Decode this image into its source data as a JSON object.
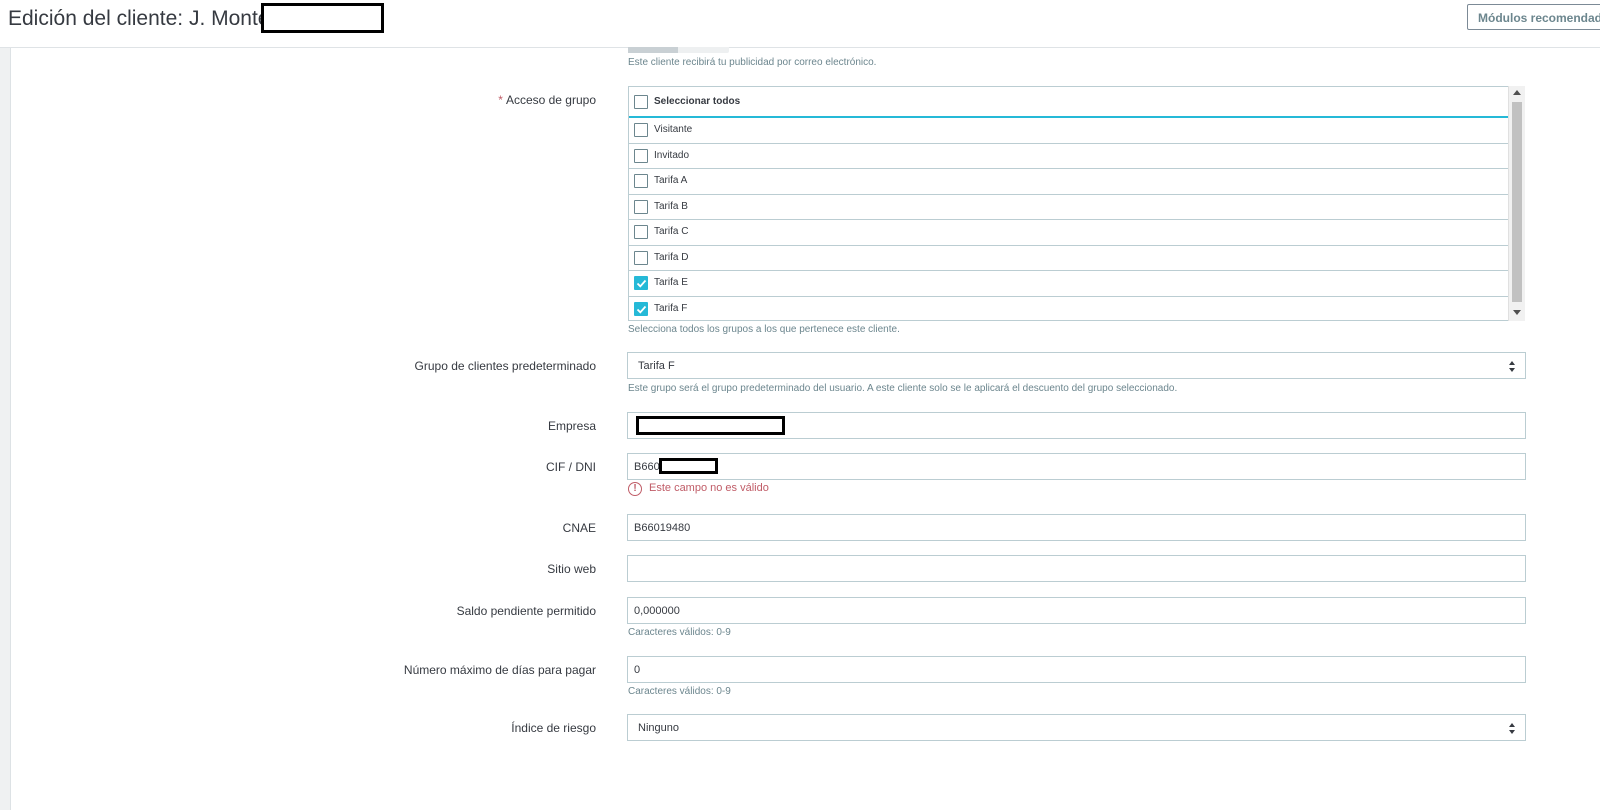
{
  "header": {
    "title": "Edición del cliente: J. Monte",
    "recommended_modules_button": "Módulos recomendados"
  },
  "newsletter_help": "Este cliente recibirá tu publicidad por correo electrónico.",
  "group_access": {
    "required_mark": "*",
    "label": "Acceso de grupo",
    "select_all": "Seleccionar todos",
    "groups": [
      {
        "label": "Visitante",
        "checked": false
      },
      {
        "label": "Invitado",
        "checked": false
      },
      {
        "label": "Tarifa A",
        "checked": false
      },
      {
        "label": "Tarifa B",
        "checked": false
      },
      {
        "label": "Tarifa C",
        "checked": false
      },
      {
        "label": "Tarifa D",
        "checked": false
      },
      {
        "label": "Tarifa E",
        "checked": true
      },
      {
        "label": "Tarifa F",
        "checked": true
      }
    ],
    "help": "Selecciona todos los grupos a los que pertenece este cliente."
  },
  "default_group": {
    "label": "Grupo de clientes predeterminado",
    "value": "Tarifa F",
    "help": "Este grupo será el grupo predeterminado del usuario. A este cliente solo se le aplicará el descuento del grupo seleccionado."
  },
  "company": {
    "label": "Empresa",
    "value": ""
  },
  "cif": {
    "label": "CIF / DNI",
    "value": "B660",
    "error_icon": "!",
    "error": "Este campo no es válido"
  },
  "cnae": {
    "label": "CNAE",
    "value": "B66019480"
  },
  "website": {
    "label": "Sitio web",
    "value": ""
  },
  "outstanding": {
    "label": "Saldo pendiente permitido",
    "value": "0,000000",
    "help": "Caracteres válidos: 0-9"
  },
  "max_days": {
    "label": "Número máximo de días para pagar",
    "value": "0",
    "help": "Caracteres válidos: 0-9"
  },
  "risk": {
    "label": "Índice de riesgo",
    "value": "Ninguno"
  },
  "colors": {
    "accent": "#25b9d7",
    "error": "#c05c67",
    "border": "#bbcdd2"
  }
}
